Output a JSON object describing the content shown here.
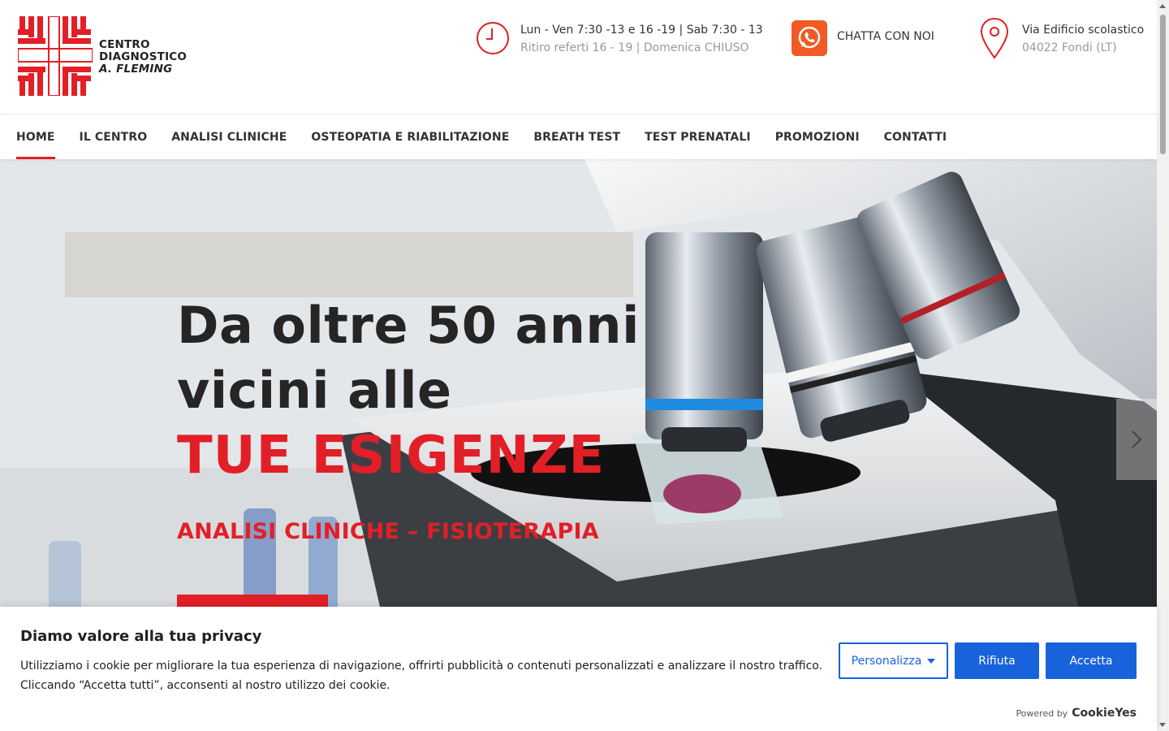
{
  "brand": {
    "line1": "CENTRO",
    "line2": "DIAGNOSTICO",
    "line3": "A. FLEMING",
    "accent": "#e21f26"
  },
  "header": {
    "hours": {
      "icon": "clock-icon",
      "line1": "Lun - Ven 7:30 -13 e 16 -19 | Sab 7:30 - 13",
      "line2": "Ritiro referti 16 - 19 | Domenica CHIUSO"
    },
    "chat": {
      "icon": "whatsapp-icon",
      "label": "CHATTA CON NOI"
    },
    "address": {
      "icon": "map-pin-icon",
      "line1": "Via Edificio scolastico",
      "line2": "04022 Fondi (LT)"
    }
  },
  "nav": {
    "items": [
      {
        "label": "HOME",
        "active": true
      },
      {
        "label": "IL CENTRO"
      },
      {
        "label": "ANALISI CLINICHE"
      },
      {
        "label": "OSTEOPATIA E RIABILITAZIONE"
      },
      {
        "label": "BREATH TEST"
      },
      {
        "label": "TEST PRENATALI"
      },
      {
        "label": "PROMOZIONI"
      },
      {
        "label": "CONTATTI"
      }
    ]
  },
  "hero": {
    "title_line1": "Da oltre 50 anni",
    "title_line2": "vicini alle",
    "title_accent": "TUE ESIGENZE",
    "subtitle": "ANALISI CLINICHE – FISIOTERAPIA",
    "next_icon": "chevron-right-icon"
  },
  "cookie": {
    "title": "Diamo valore alla tua privacy",
    "text": "Utilizziamo i cookie per migliorare la tua esperienza di navigazione, offrirti pubblicità o contenuti personalizzati e analizzare il nostro traffico. Cliccando “Accetta tutti”, acconsenti al nostro utilizzo dei cookie.",
    "customize_label": "Personalizza",
    "reject_label": "Rifiuta",
    "accept_label": "Accetta",
    "powered_by": "Powered by",
    "powered_brand": "CookieYes",
    "button_color": "#1863dc"
  }
}
